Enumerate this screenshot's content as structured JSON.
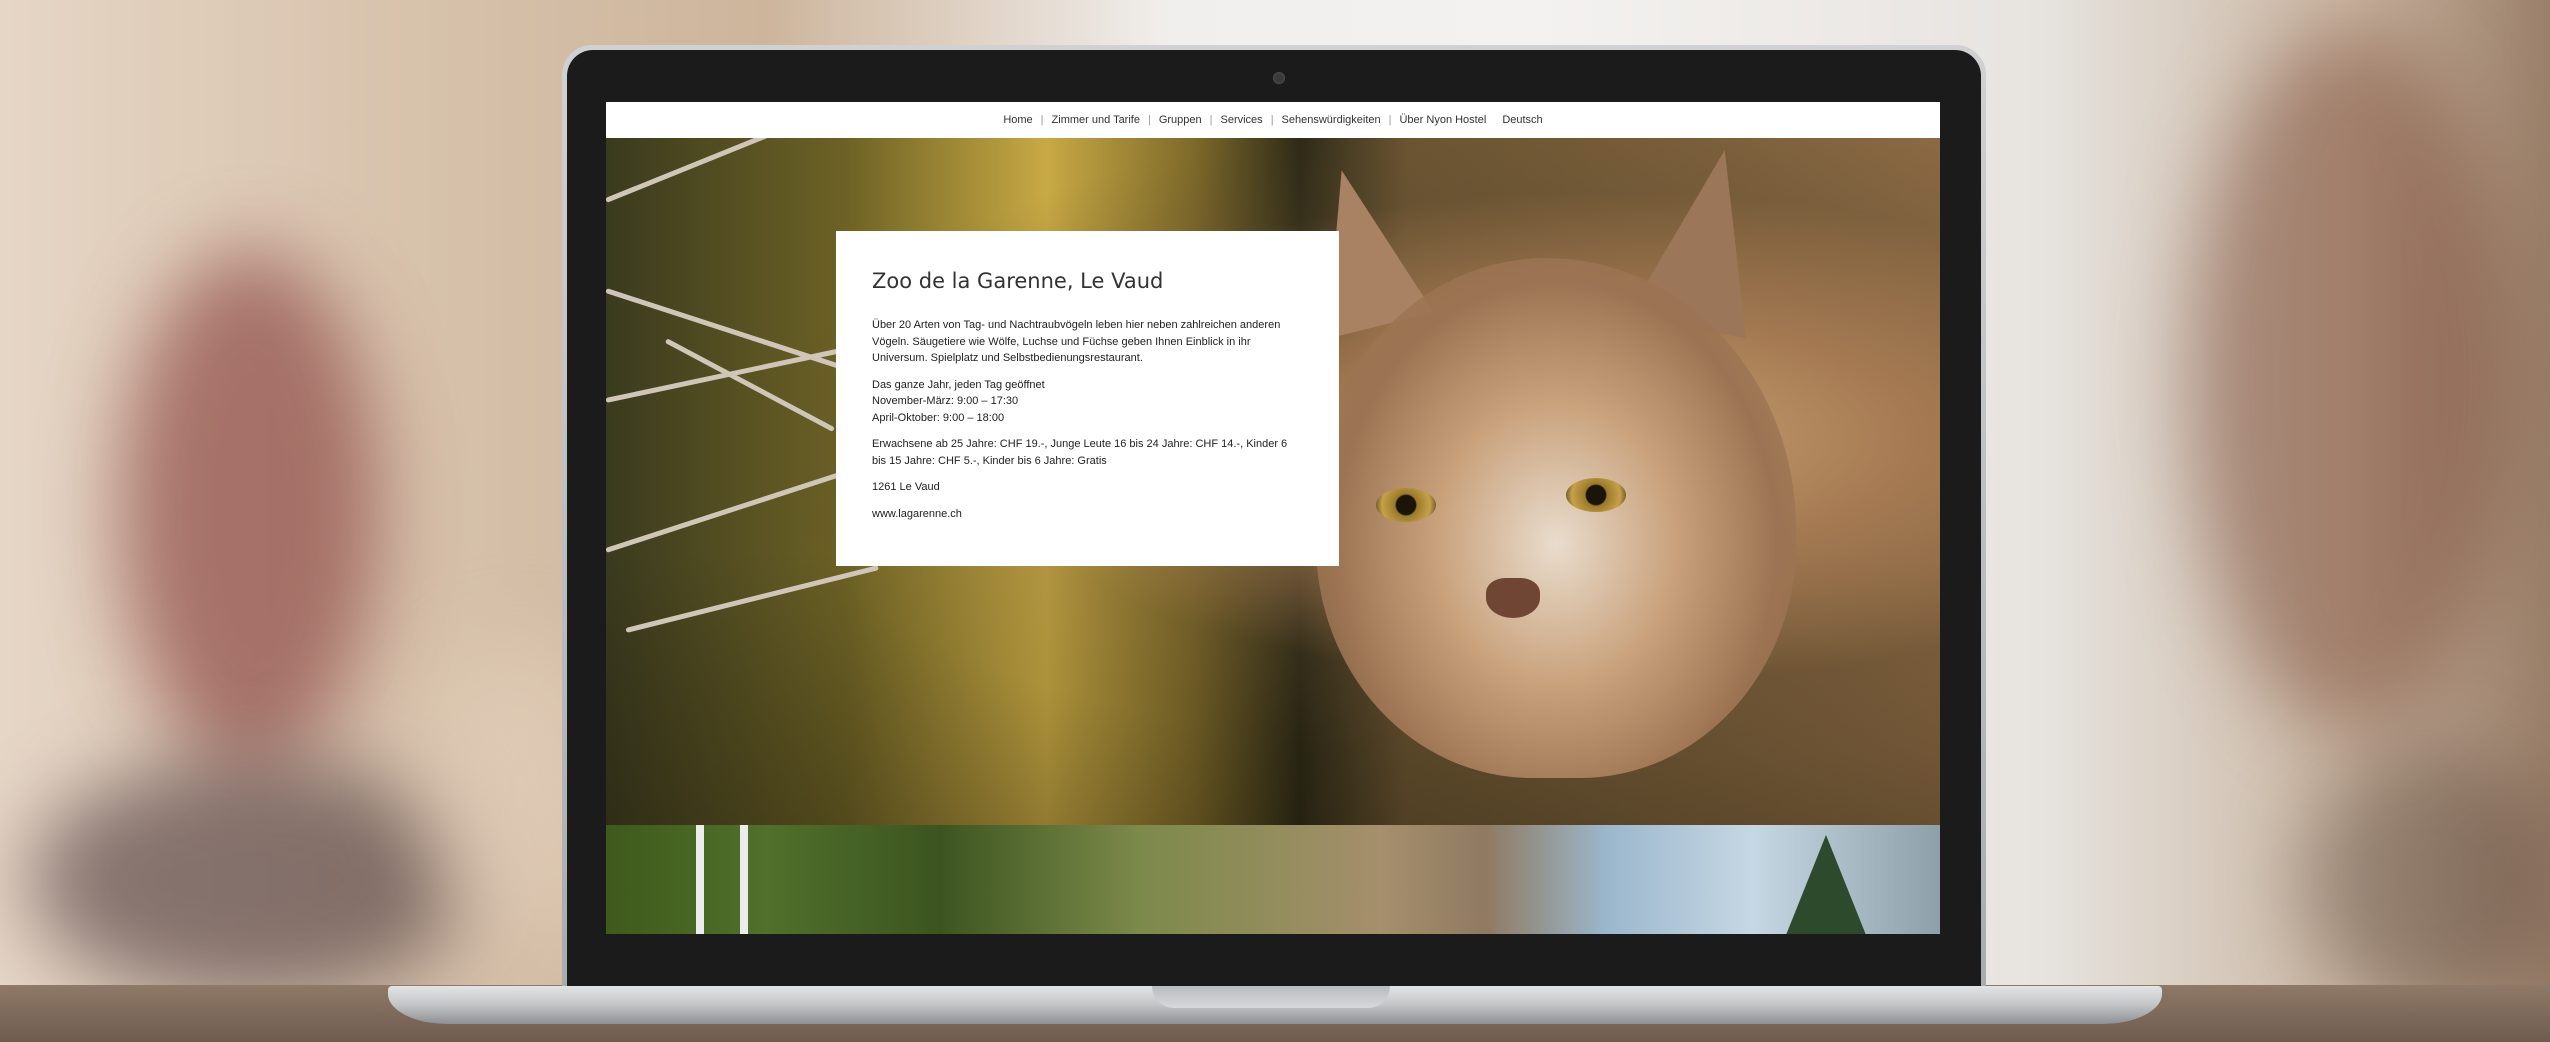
{
  "nav": {
    "items": [
      "Home",
      "Zimmer und Tarife",
      "Gruppen",
      "Services",
      "Sehenswürdigkeiten",
      "Über Nyon Hostel",
      "Deutsch"
    ],
    "separator": "|"
  },
  "card": {
    "title": "Zoo de la Garenne, Le Vaud",
    "description": "Über 20 Arten von Tag- und Nachtraubvögeln leben hier neben zahlreichen anderen Vögeln. Säugetiere wie Wölfe, Luchse und Füchse geben Ihnen Einblick in ihr Universum. Spielplatz und Selbstbedienungsrestaurant.",
    "hours_line1": "Das ganze Jahr, jeden Tag geöffnet",
    "hours_line2": "November-März: 9:00 – 17:30",
    "hours_line3": "April-Oktober: 9:00 – 18:00",
    "prices": "Erwachsene ab 25 Jahre: CHF 19.-, Junge Leute 16 bis 24 Jahre: CHF 14.-, Kinder 6 bis 15 Jahre: CHF 5.-, Kinder bis 6 Jahre: Gratis",
    "address": "1261 Le Vaud",
    "website": "www.lagarenne.ch"
  }
}
